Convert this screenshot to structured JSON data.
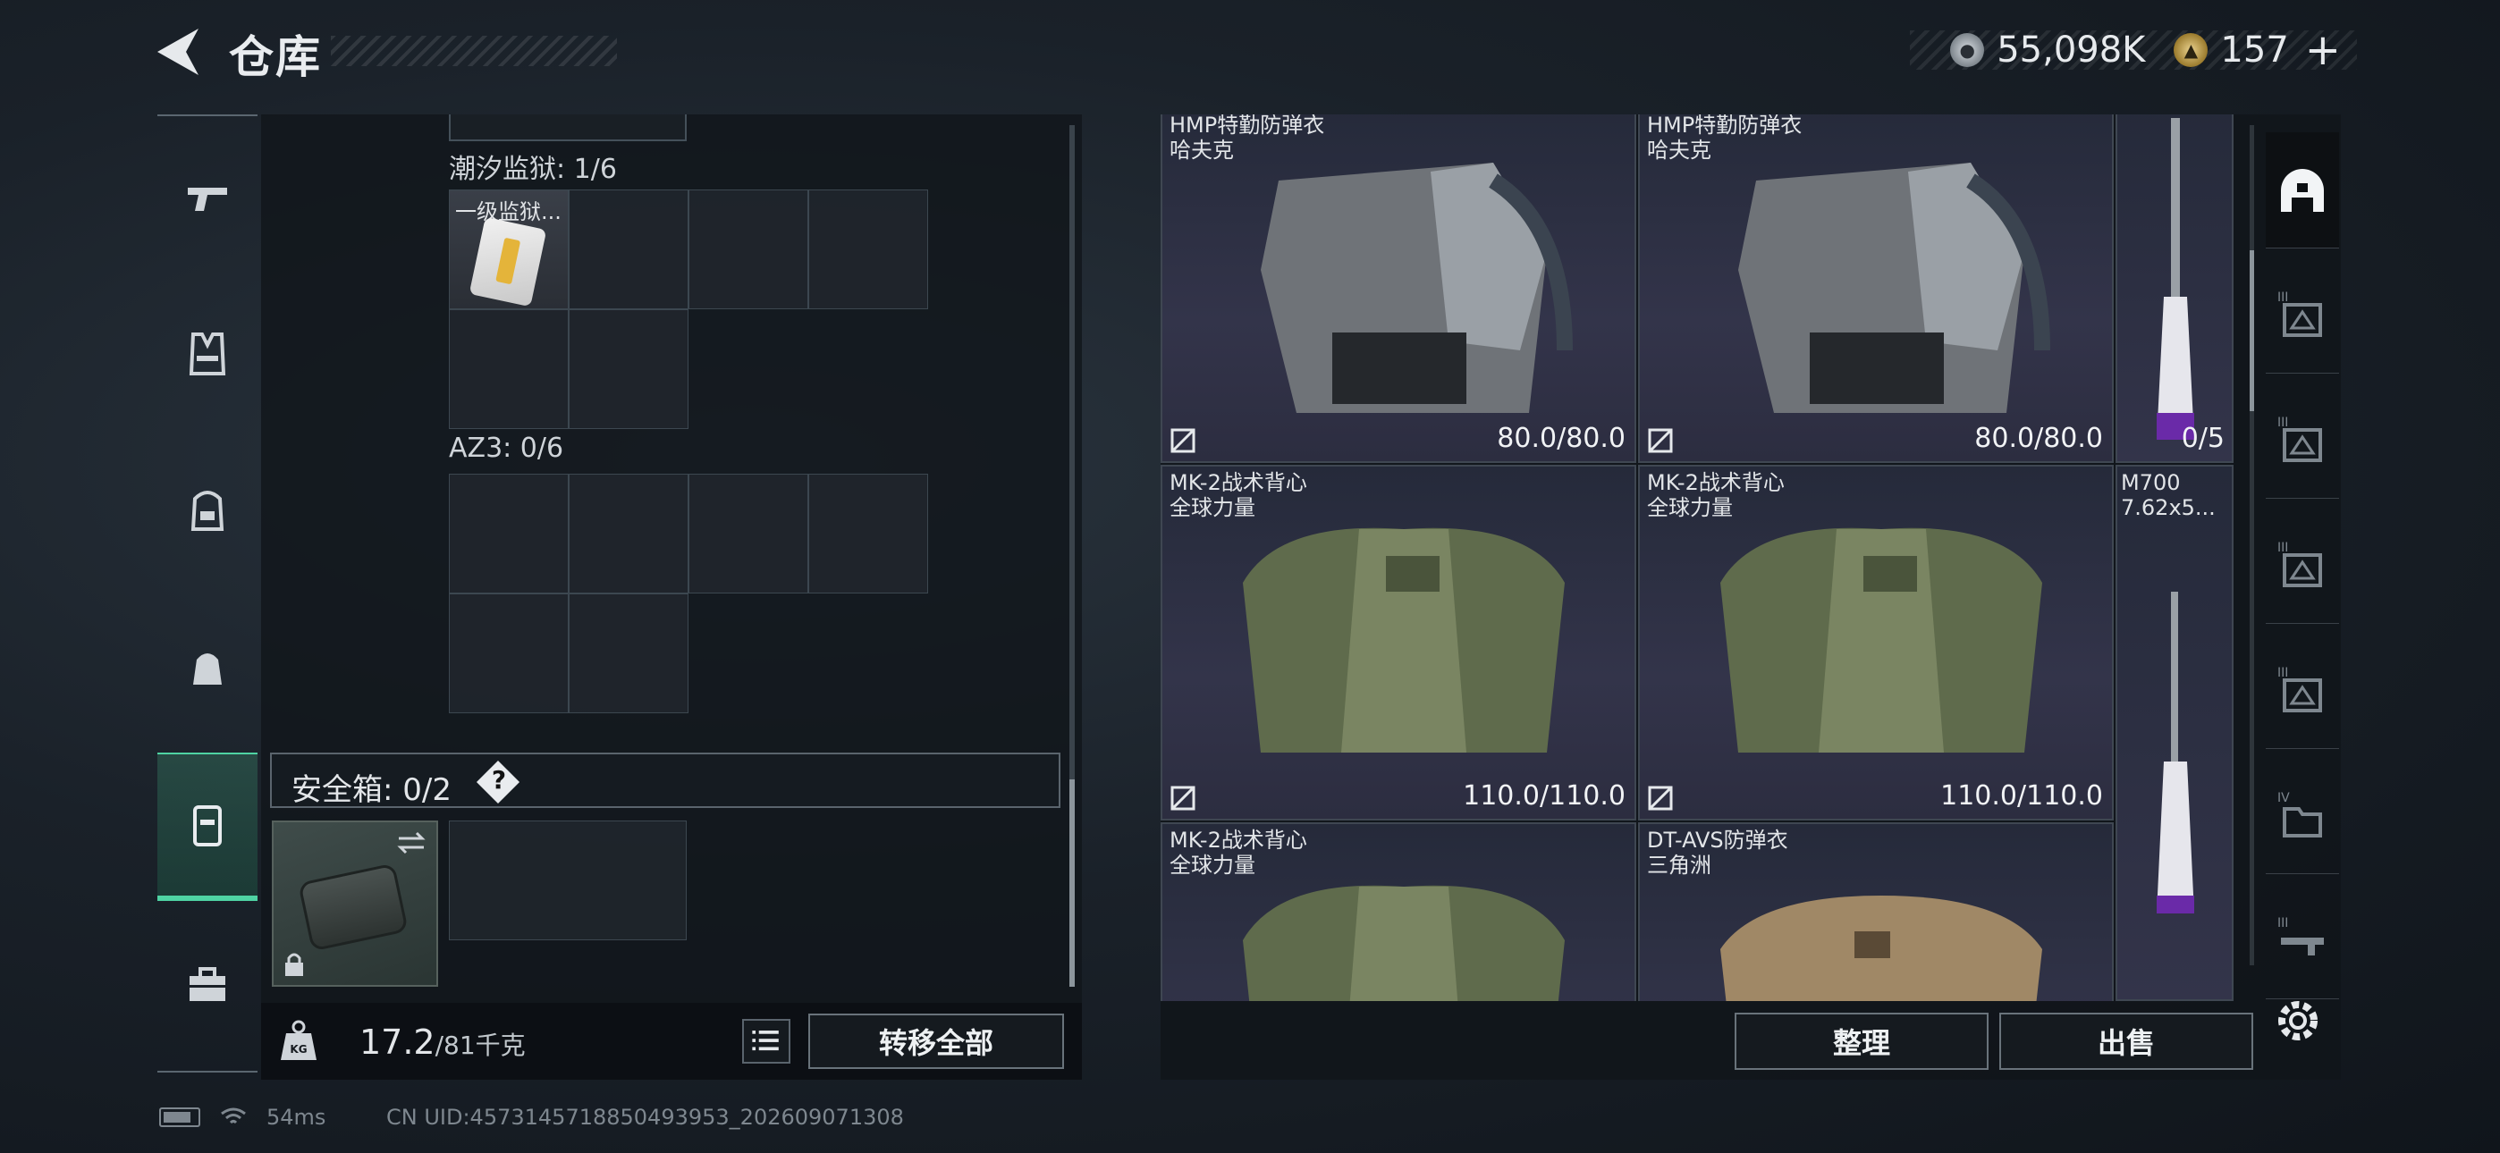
{
  "header": {
    "title": "仓库",
    "currency": {
      "silver_value": "55,098K",
      "gold_value": "157",
      "plus_label": "+"
    }
  },
  "left_nav": [
    "pistol-icon",
    "armor-vest-icon",
    "backpack-icon",
    "bag-icon",
    "safe-box-icon",
    "toolbox-icon"
  ],
  "left_panel": {
    "containers": [
      {
        "label": "潮汐监狱: 1/6",
        "item_label": "一级监狱..."
      },
      {
        "label": "AZ3: 0/6"
      }
    ],
    "safe_box": {
      "label": "安全箱: 0/2",
      "help": "?"
    },
    "weight_value": "17.2",
    "weight_max": "/81千克",
    "transfer_all": "转移全部"
  },
  "inventory": {
    "tiles": [
      {
        "name1": "HMP特勤防弹衣",
        "name2": "哈夫克",
        "durability": "80.0/80.0"
      },
      {
        "name1": "HMP特勤防弹衣",
        "name2": "哈夫克",
        "durability": "80.0/80.0"
      },
      {
        "name1": "MK-2战术背心",
        "name2": "全球力量",
        "durability": "110.0/110.0"
      },
      {
        "name1": "MK-2战术背心",
        "name2": "全球力量",
        "durability": "110.0/110.0"
      },
      {
        "name1": "MK-2战术背心",
        "name2": "全球力量",
        "durability": ""
      },
      {
        "name1": "DT-AVS防弹衣",
        "name2": "三角洲",
        "durability": ""
      }
    ],
    "rifles": [
      {
        "name1": "",
        "name2": "",
        "durability": "0/5"
      },
      {
        "name1": "M700",
        "name2": "7.62x5...",
        "durability": ""
      },
      {
        "name1": "",
        "name2": "",
        "durability": ""
      }
    ],
    "sort_label": "整理",
    "sell_label": "出售"
  },
  "right_nav": {
    "tiers": [
      "",
      "III",
      "III",
      "III",
      "III",
      "IV",
      "III"
    ]
  },
  "status": {
    "ping": "54ms",
    "uid": "CN UID:4573145718850493953_202609071308"
  },
  "colors": {
    "accent": "#4fd3a3",
    "tile_bg": "#2c2d40"
  }
}
